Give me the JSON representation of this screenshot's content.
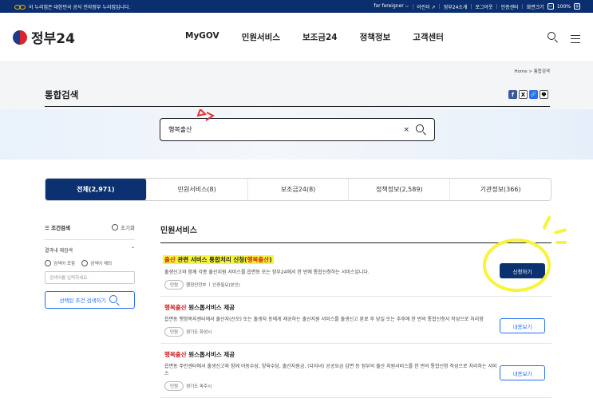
{
  "topbar": {
    "notice": "이 누리집은 대한민국 공식 전자정부 누리집입니다.",
    "links": [
      "for foreigner ⌵",
      "어린이 ↗",
      "정부24소개",
      "로그아웃",
      "인증센터",
      "화면크기"
    ],
    "zoom": "100%",
    "zoom_minus": "−",
    "zoom_plus": "+"
  },
  "header": {
    "logo": "정부24",
    "nav": [
      "MyGOV",
      "민원서비스",
      "보조금24",
      "정책정보",
      "고객센터"
    ],
    "search_icon": "search-icon",
    "menu_icon": "hamburger-icon"
  },
  "breadcrumb": {
    "home": "Home",
    "sep": ">",
    "current": "통합검색"
  },
  "page_title": "통합검색",
  "share": [
    "f",
    "X",
    "🔗",
    "🖶"
  ],
  "search": {
    "value": "행복출산",
    "clear": "×"
  },
  "tabs": [
    {
      "label": "전체(2,971)",
      "active": true
    },
    {
      "label": "민원서비스(8)"
    },
    {
      "label": "보조금24(8)"
    },
    {
      "label": "정책정보(2,589)"
    },
    {
      "label": "기관정보(366)"
    }
  ],
  "sidebar": {
    "filter_label": "조건검색",
    "reset_label": "초기화",
    "research_label": "결과내 재검색",
    "include_label": "검색어 포함",
    "exclude_label": "검색어 제외",
    "input_placeholder": "검색어를 입력하세요.",
    "apply_label": "선택된 조건 검색하기"
  },
  "results": {
    "section_title": "민원서비스",
    "items": [
      {
        "title_a": "출산",
        "title_b": " 관련 서비스 통합처리 신청(",
        "title_c": "행복출산",
        "title_d": ")",
        "desc": "출생신고와 함께 각종 출산지원 서비스를 읍면동 또는 정부24에서 한 번에 통합신청하는 서비스입니다.",
        "badge": "민원",
        "org": "행정안전부",
        "extra": "인증필요(본인)",
        "button": "신청하기"
      },
      {
        "title_a": "행복출산",
        "title_b": " 원스톱서비스 제공",
        "desc": "읍면동 행정복지센터에서 출산자(산모) 또는 출생자 등에게 제공하는 출산지원 서비스를 출생신고 완료 후 당일 또는 추후에 한 번의 통합신청서 작성으로 처리함",
        "badge": "민원",
        "org": "경기도 화성시",
        "button": "내용보기"
      },
      {
        "title_a": "행복출산",
        "title_b": " 원스톱서비스 제공",
        "desc": "읍면동 주민센터에서 출생신고와 함께 아동수당, 양육수당, 출산지원금, (다자녀) 공공요금 감면 등 정부의 출산 지원서비스를 한 번의 통합신청 작성으로 처리하는 서비스",
        "badge": "민원",
        "org": "경기도 파주시",
        "button": "내용보기"
      }
    ]
  },
  "colors": {
    "primary": "#0b3171",
    "accent_blue": "#256ef4",
    "highlight": "#f8f43a",
    "keyword_red": "#d21e1e"
  }
}
